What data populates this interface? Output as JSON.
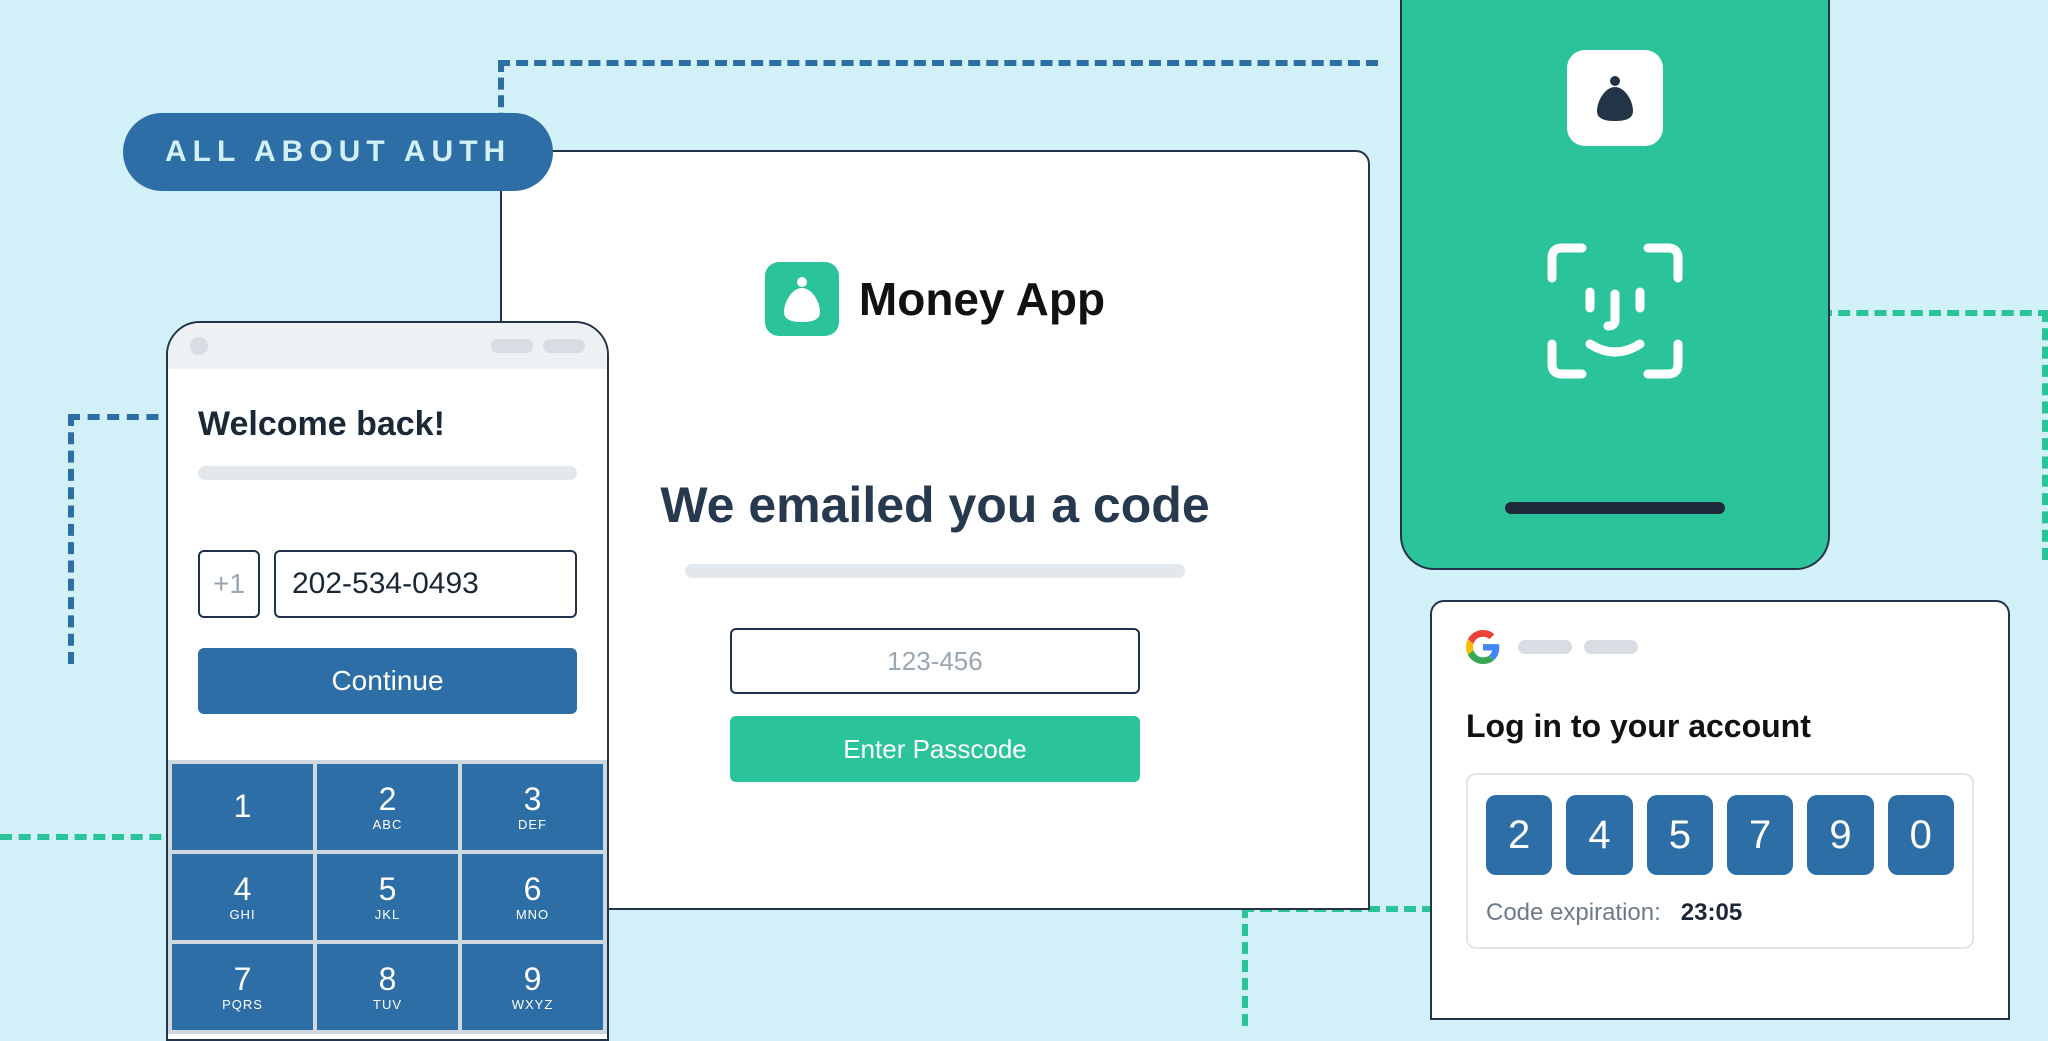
{
  "badge": {
    "label": "ALL ABOUT AUTH"
  },
  "phone_left": {
    "welcome": "Welcome back!",
    "prefix": "+1",
    "phone_value": "202-534-0493",
    "continue_label": "Continue",
    "keys": [
      {
        "digit": "1",
        "letters": ""
      },
      {
        "digit": "2",
        "letters": "ABC"
      },
      {
        "digit": "3",
        "letters": "DEF"
      },
      {
        "digit": "4",
        "letters": "GHI"
      },
      {
        "digit": "5",
        "letters": "JKL"
      },
      {
        "digit": "6",
        "letters": "MNO"
      },
      {
        "digit": "7",
        "letters": "PQRS"
      },
      {
        "digit": "8",
        "letters": "TUV"
      },
      {
        "digit": "9",
        "letters": "WXYZ"
      }
    ]
  },
  "center": {
    "brand": "Money App",
    "heading": "We emailed you a code",
    "placeholder": "123-456",
    "button_label": "Enter Passcode"
  },
  "login_card": {
    "title": "Log in to your account",
    "otp": [
      "2",
      "4",
      "5",
      "7",
      "9",
      "0"
    ],
    "expire_label": "Code expiration:",
    "expire_time": "23:05"
  },
  "colors": {
    "blue": "#2e6ea6",
    "teal": "#2bc49a"
  }
}
